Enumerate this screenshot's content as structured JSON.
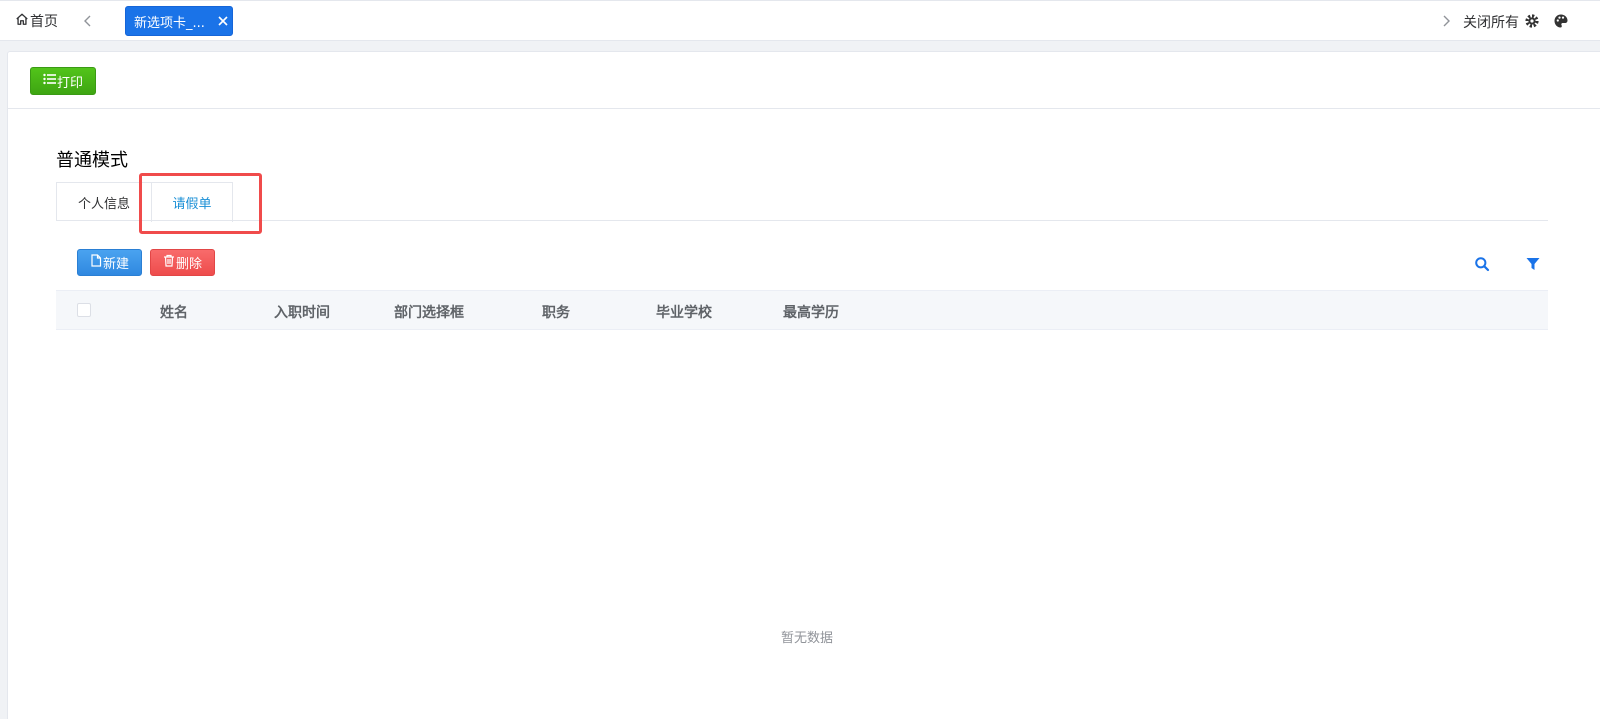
{
  "topbar": {
    "home_label": "首页",
    "active_tab_label": "新选项卡_...",
    "close_all_label": "关闭所有"
  },
  "toolbar": {
    "print_label": "打印"
  },
  "main": {
    "mode_title": "普通模式",
    "tabs": [
      {
        "label": "个人信息",
        "active": false
      },
      {
        "label": "请假单",
        "active": true
      }
    ],
    "actions": {
      "new_label": "新建",
      "delete_label": "删除"
    },
    "table": {
      "columns": [
        "姓名",
        "入职时间",
        "部门选择框",
        "职务",
        "毕业学校",
        "最高学历"
      ],
      "rows": [],
      "empty_text": "暂无数据"
    }
  },
  "colors": {
    "primary": "#1a73e8",
    "success": "#52c41a",
    "danger": "#ee4c4c",
    "highlight": "#f04b4b",
    "tab_active_text": "#1a8fd6"
  },
  "icons": [
    "home-icon",
    "chevron-left-icon",
    "close-icon",
    "chevron-right-icon",
    "gear-icon",
    "palette-icon",
    "list-icon",
    "file-icon",
    "trash-icon",
    "search-icon",
    "filter-icon"
  ]
}
